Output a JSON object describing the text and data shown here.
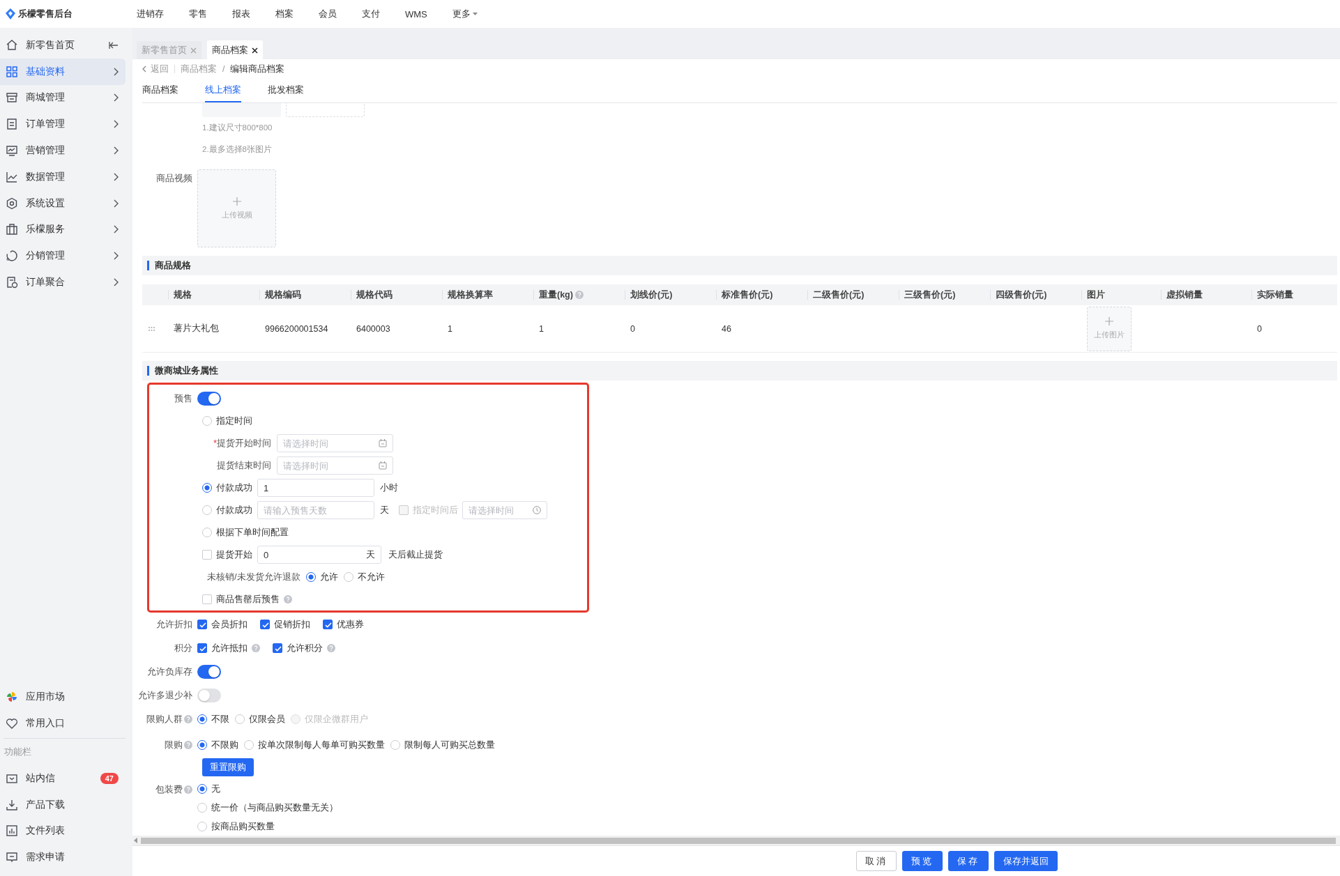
{
  "app": {
    "title": "乐檬零售后台"
  },
  "top_nav": [
    {
      "label": "进销存",
      "dropdown": false
    },
    {
      "label": "零售",
      "dropdown": false
    },
    {
      "label": "报表",
      "dropdown": false
    },
    {
      "label": "档案",
      "dropdown": false
    },
    {
      "label": "会员",
      "dropdown": false
    },
    {
      "label": "支付",
      "dropdown": false
    },
    {
      "label": "WMS",
      "dropdown": false
    },
    {
      "label": "更多",
      "dropdown": true
    }
  ],
  "sidebar": {
    "items": [
      {
        "label": "新零售首页",
        "kind": "home",
        "selected": false
      },
      {
        "label": "基础资料",
        "kind": "menu",
        "selected": true
      },
      {
        "label": "商城管理",
        "kind": "menu",
        "selected": false
      },
      {
        "label": "订单管理",
        "kind": "menu",
        "selected": false
      },
      {
        "label": "营销管理",
        "kind": "menu",
        "selected": false
      },
      {
        "label": "数据管理",
        "kind": "menu",
        "selected": false
      },
      {
        "label": "系统设置",
        "kind": "menu",
        "selected": false
      },
      {
        "label": "乐檬服务",
        "kind": "menu",
        "selected": false
      },
      {
        "label": "分销管理",
        "kind": "menu",
        "selected": false
      },
      {
        "label": "订单聚合",
        "kind": "menu",
        "selected": false
      }
    ],
    "extra_items": [
      {
        "label": "应用市场"
      },
      {
        "label": "常用入口"
      }
    ],
    "section_title": "功能栏",
    "tools": [
      {
        "label": "站内信",
        "badge": "47"
      },
      {
        "label": "产品下载"
      },
      {
        "label": "文件列表"
      },
      {
        "label": "需求申请"
      }
    ]
  },
  "page_tabs": [
    {
      "label": "新零售首页",
      "selected": false
    },
    {
      "label": "商品档案",
      "selected": true
    }
  ],
  "breadcrumb": {
    "back": "返回",
    "separator": "/",
    "items": [
      "商品档案",
      "编辑商品档案"
    ]
  },
  "sub_tabs": [
    {
      "label": "商品档案",
      "selected": false
    },
    {
      "label": "线上档案",
      "selected": true
    },
    {
      "label": "批发档案",
      "selected": false
    }
  ],
  "image_upload": {
    "hints": [
      "1.建议尺寸800*800",
      "2.最多选择8张图片"
    ]
  },
  "video": {
    "label": "商品视频",
    "upload_text": "上传视频"
  },
  "spec_section": {
    "title": "商品规格",
    "table": {
      "columns": [
        {
          "label": "规格",
          "help": false
        },
        {
          "label": "规格编码",
          "help": false
        },
        {
          "label": "规格代码",
          "help": false
        },
        {
          "label": "规格换算率",
          "help": false
        },
        {
          "label": "重量(kg)",
          "help": true
        },
        {
          "label": "划线价(元)",
          "help": false
        },
        {
          "label": "标准售价(元)",
          "help": false
        },
        {
          "label": "二级售价(元)",
          "help": false
        },
        {
          "label": "三级售价(元)",
          "help": false
        },
        {
          "label": "四级售价(元)",
          "help": false
        },
        {
          "label": "图片",
          "help": false
        },
        {
          "label": "虚拟销量",
          "help": false
        },
        {
          "label": "实际销量",
          "help": false
        }
      ],
      "rows": [
        {
          "cells": [
            "薯片大礼包",
            "9966200001534",
            "6400003",
            "1",
            "1",
            "0",
            "46",
            null,
            null,
            null,
            {
              "upload_text": "上传图片"
            },
            null,
            "0"
          ]
        }
      ]
    }
  },
  "biz_section": {
    "title": "微商城业务属性"
  },
  "presale": {
    "highlighted": true,
    "label": "预售",
    "on": true,
    "options": [
      {
        "kind": "radio",
        "label": "指定时间",
        "selected": false
      },
      {
        "kind": "date",
        "required_mark": "*",
        "label": "提货开始时间",
        "placeholder": "请选择时间"
      },
      {
        "kind": "date",
        "label": "提货结束时间",
        "placeholder": "请选择时间"
      },
      {
        "kind": "radio_input",
        "label": "付款成功",
        "selected": true,
        "value": "1",
        "unit": "小时"
      },
      {
        "kind": "radio_input",
        "label": "付款成功",
        "selected": false,
        "placeholder": "请输入预售天数",
        "unit": "天",
        "extra": {
          "label": "指定时间后",
          "checked": false,
          "disabled": true,
          "placeholder": "请选择时间"
        }
      },
      {
        "kind": "radio",
        "label": "根据下单时间配置",
        "selected": false
      },
      {
        "kind": "check_input",
        "label": "提货开始",
        "checked": false,
        "value": "0",
        "suffix": "天",
        "unit": "天后截止提货"
      },
      {
        "kind": "radio_group",
        "label": "未核销/未发货允许退款",
        "options": [
          {
            "label": "允许",
            "selected": true
          },
          {
            "label": "不允许",
            "selected": false
          }
        ]
      },
      {
        "kind": "check",
        "label": "商品售罄后预售",
        "checked": false,
        "help": true
      }
    ]
  },
  "settings": [
    {
      "kind": "checks",
      "label": "允许折扣",
      "help": false,
      "options": [
        {
          "label": "会员折扣",
          "checked": true,
          "help": false
        },
        {
          "label": "促销折扣",
          "checked": true,
          "help": false
        },
        {
          "label": "优惠券",
          "checked": true,
          "help": false
        }
      ]
    },
    {
      "kind": "checks",
      "label": "积分",
      "help": false,
      "options": [
        {
          "label": "允许抵扣",
          "checked": true,
          "help": true
        },
        {
          "label": "允许积分",
          "checked": true,
          "help": true
        }
      ]
    },
    {
      "kind": "switch",
      "label": "允许负库存",
      "help": false,
      "on": true
    },
    {
      "kind": "switch",
      "label": "允许多退少补",
      "help": false,
      "on": false
    },
    {
      "kind": "radios",
      "label": "限购人群",
      "help": true,
      "options": [
        {
          "label": "不限",
          "selected": true,
          "disabled": false
        },
        {
          "label": "仅限会员",
          "selected": false,
          "disabled": false
        },
        {
          "label": "仅限企微群用户",
          "selected": false,
          "disabled": true
        }
      ]
    },
    {
      "kind": "radios",
      "label": "限购",
      "help": true,
      "options": [
        {
          "label": "不限购",
          "selected": true
        },
        {
          "label": "按单次限制每人每单可购买数量",
          "selected": false
        },
        {
          "label": "限制每人可购买总数量",
          "selected": false
        }
      ],
      "button": "重置限购"
    },
    {
      "kind": "radios",
      "label": "包装费",
      "help": true,
      "vertical": true,
      "options": [
        {
          "label": "无",
          "selected": true
        },
        {
          "label": "统一价（与商品购买数量无关）",
          "selected": false
        },
        {
          "label": "按商品购买数量",
          "selected": false
        }
      ]
    }
  ],
  "footer": {
    "buttons": [
      {
        "label": "取消",
        "primary": false
      },
      {
        "label": "预览",
        "primary": true
      },
      {
        "label": "保存",
        "primary": true
      },
      {
        "label": "保存并返回",
        "primary": true
      }
    ]
  }
}
